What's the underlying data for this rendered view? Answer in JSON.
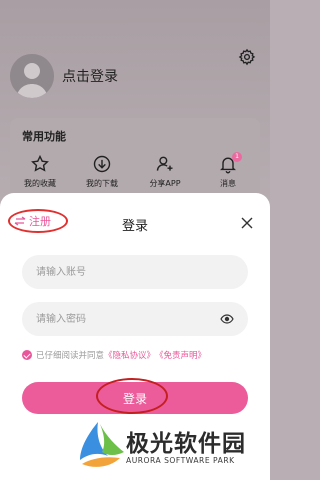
{
  "profile": {
    "login_prompt": "点击登录"
  },
  "features": {
    "title": "常用功能",
    "items": [
      {
        "label": "我的收藏",
        "icon": "star-icon"
      },
      {
        "label": "我的下载",
        "icon": "download-icon"
      },
      {
        "label": "分享APP",
        "icon": "share-user-icon"
      },
      {
        "label": "消息",
        "icon": "bell-icon",
        "badge": "1"
      }
    ]
  },
  "login_sheet": {
    "register_label": "注册",
    "title": "登录",
    "account_placeholder": "请输入账号",
    "password_placeholder": "请输入密码",
    "agree_prefix": "已仔细阅读并同意",
    "privacy_link": "《隐私协议》",
    "disclaimer_link": "《免责声明》",
    "login_label": "登录"
  },
  "watermark": {
    "name": "极光软件园",
    "sub": "AURORA SOFTWARE PARK"
  },
  "colors": {
    "accent": "#ec5c9b",
    "annotation_red": "#e0302f"
  }
}
